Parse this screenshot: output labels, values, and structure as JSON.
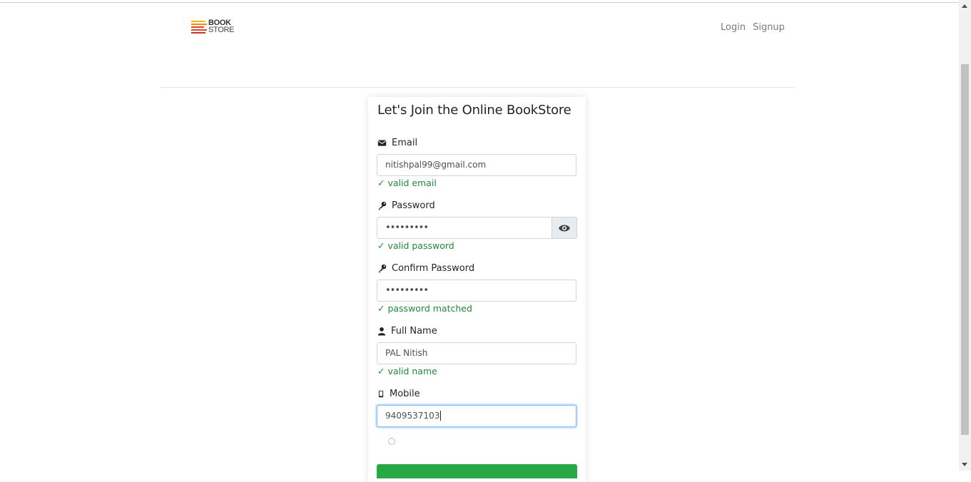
{
  "header": {
    "logo": {
      "line1": "BOOK",
      "line2": "STORE"
    },
    "nav": {
      "login": "Login",
      "signup": "Signup"
    }
  },
  "form": {
    "title": "Let's Join the Online BookStore",
    "email": {
      "label": "Email",
      "value": "nitishpal99@gmail.com",
      "status": "✓ valid email"
    },
    "password": {
      "label": "Password",
      "value": "•••••••••",
      "status": "✓ valid password"
    },
    "confirm_password": {
      "label": "Confirm Password",
      "value": "•••••••••",
      "status": "✓ password matched"
    },
    "full_name": {
      "label": "Full Name",
      "value": "PAL Nitish",
      "status": "✓ valid name"
    },
    "mobile": {
      "label": "Mobile",
      "value": "9409537103"
    }
  },
  "colors": {
    "valid": "#218838",
    "submit": "#28a745",
    "focus_border": "#80bdff",
    "logo_bars": [
      "#f2b705",
      "#e8412c",
      "#2a9d8f",
      "#f2b705",
      "#e8412c"
    ]
  }
}
